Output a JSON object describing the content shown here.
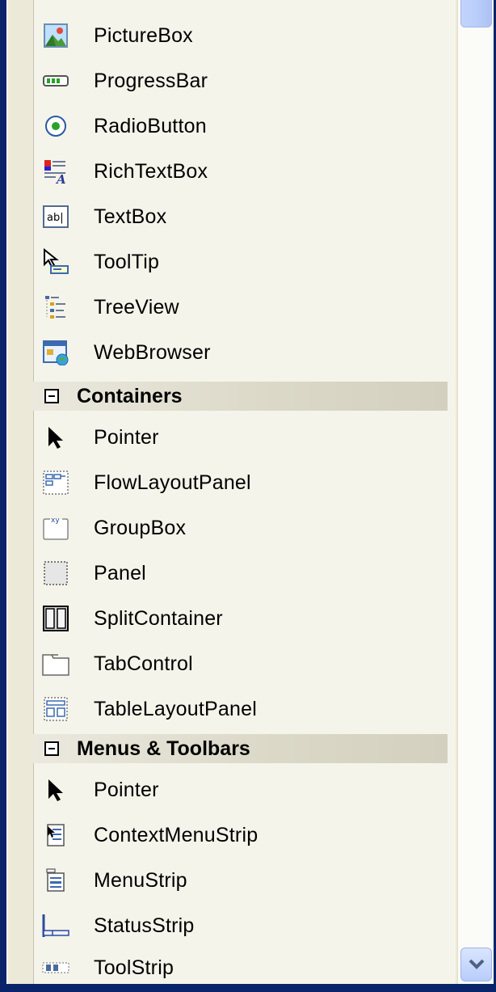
{
  "toolbox": {
    "common_items": [
      {
        "label": "PictureBox",
        "icon": "picturebox-icon"
      },
      {
        "label": "ProgressBar",
        "icon": "progressbar-icon"
      },
      {
        "label": "RadioButton",
        "icon": "radiobutton-icon"
      },
      {
        "label": "RichTextBox",
        "icon": "richtextbox-icon"
      },
      {
        "label": "TextBox",
        "icon": "textbox-icon"
      },
      {
        "label": "ToolTip",
        "icon": "tooltip-icon"
      },
      {
        "label": "TreeView",
        "icon": "treeview-icon"
      },
      {
        "label": "WebBrowser",
        "icon": "webbrowser-icon"
      }
    ],
    "containers": {
      "title": "Containers",
      "items": [
        {
          "label": "Pointer",
          "icon": "pointer-icon"
        },
        {
          "label": "FlowLayoutPanel",
          "icon": "flowlayoutpanel-icon"
        },
        {
          "label": "GroupBox",
          "icon": "groupbox-icon"
        },
        {
          "label": "Panel",
          "icon": "panel-icon"
        },
        {
          "label": "SplitContainer",
          "icon": "splitcontainer-icon"
        },
        {
          "label": "TabControl",
          "icon": "tabcontrol-icon"
        },
        {
          "label": "TableLayoutPanel",
          "icon": "tablelayoutpanel-icon"
        }
      ]
    },
    "menus_toolbars": {
      "title": "Menus & Toolbars",
      "items": [
        {
          "label": "Pointer",
          "icon": "pointer-icon"
        },
        {
          "label": "ContextMenuStrip",
          "icon": "contextmenustrip-icon"
        },
        {
          "label": "MenuStrip",
          "icon": "menustrip-icon"
        },
        {
          "label": "StatusStrip",
          "icon": "statusstrip-icon"
        },
        {
          "label": "ToolStrip",
          "icon": "toolstrip-icon"
        }
      ]
    }
  },
  "colors": {
    "frame": "#0a246a",
    "pane_background": "#f5f4ea",
    "scrollbar_accent": "#bbcefb"
  }
}
